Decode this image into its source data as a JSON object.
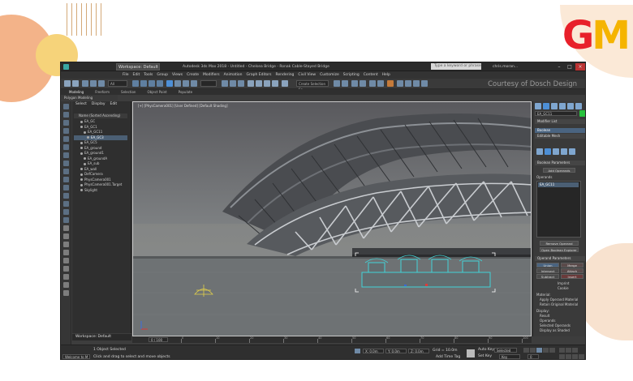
{
  "brand": {
    "logo_g": "G",
    "logo_m": "M"
  },
  "window": {
    "workspace_label": "Workspace: Default",
    "title": "Autodesk 3ds Max 2018 - Untitled - Chelsea Bridge - Ronak Cable-Stayed Bridge",
    "search_placeholder": "Type a keyword or phrase",
    "user": "chris.moran...",
    "minimize": "–",
    "maximize": "□",
    "close": "×"
  },
  "menus": [
    "File",
    "Edit",
    "Tools",
    "Group",
    "Views",
    "Create",
    "Modifiers",
    "Animation",
    "Graph Editors",
    "Rendering",
    "Civil View",
    "Customize",
    "Scripting",
    "Content",
    "Help"
  ],
  "toolbar": {
    "selection_filter": "All",
    "named_selection": "Create Selection Se",
    "courtesy": "Courtesy of Dosch Design"
  },
  "ribbon": {
    "tabs": [
      "Modeling",
      "Freeform",
      "Selection",
      "Object Paint",
      "Populate"
    ],
    "active_tab": "Modeling",
    "sub": "Polygon Modeling"
  },
  "explorer": {
    "tabs": [
      "Select",
      "Display",
      "Edit"
    ],
    "header": "Name (Sorted Ascending)",
    "items": [
      "EA_GC",
      "EA_GC1",
      "EA_GC11",
      "EA_GC3",
      "EA_GC5",
      "EA_ground",
      "EA_ground1",
      "EA_groundA",
      "EA_sub",
      "EA_wall",
      "DefCamera",
      "PhysCamera001",
      "PhysCamera001.Target",
      "Skylight"
    ],
    "selected_item": "EA_GC3",
    "workspace_footer": "Workspace: Default"
  },
  "viewport": {
    "label": "[+] [PhysCamera001] [User Defined] [Default Shading]"
  },
  "command_panel": {
    "object_name": "EA_GC11",
    "modifier_list_label": "Modifier List",
    "stack": [
      "Boolean",
      "Editable Mesh"
    ],
    "rollout_boolean": "Boolean Parameters",
    "add_operands": "Add Operands",
    "operands_label": "Operands",
    "operand_item": "EA_GC11",
    "remove_operand": "Remove Operand",
    "open_explorer": "Open Boolean Explorer",
    "rollout_operand": "Operand Parameters",
    "ops": [
      "Union",
      "Merge",
      "Intersect",
      "Attach",
      "Subtract",
      "Insert"
    ],
    "imprint": "Imprint",
    "cookie": "Cookie",
    "material_label": "Material:",
    "material_opts": [
      "Apply Operand Material",
      "Retain Original Material"
    ],
    "display_label": "Display:",
    "display_opts": [
      "Result",
      "Operands",
      "Selected Operands",
      "Display as Shaded"
    ]
  },
  "timeline": {
    "frame_counter": "0 / 100",
    "tick_labels": [
      "0",
      "10",
      "20",
      "30",
      "40",
      "50",
      "60",
      "70",
      "80",
      "90",
      "100"
    ]
  },
  "status": {
    "maxscript": "Welcome to M",
    "selection": "1 Object Selected",
    "prompt": "Click and drag to select and move objects",
    "x": "X: 0.0m",
    "y": "Y: 0.0m",
    "z": "Z: 0.0m",
    "grid": "Grid = 10.0m",
    "add_time_tag": "Add Time Tag",
    "auto_key": "Auto Key",
    "set_key": "Set Key",
    "selected": "Selected",
    "key_filters": "Key Filters...",
    "frame": "0"
  },
  "colors": {
    "selection_cyan": "#41d3d7",
    "ui_dark": "#3d3d3d",
    "logo_red": "#e8202a",
    "logo_yellow": "#f5b400"
  }
}
